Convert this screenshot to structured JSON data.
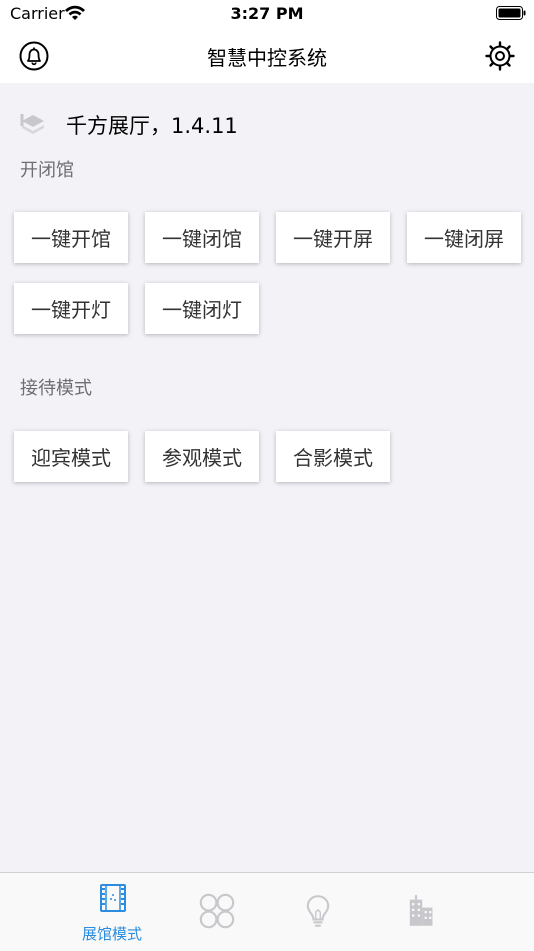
{
  "status_bar": {
    "carrier": "Carrier",
    "time": "3:27 PM"
  },
  "nav": {
    "title": "智慧中控系统",
    "left_icon": "bell-icon",
    "right_icon": "gear-icon"
  },
  "hall": {
    "name": "千方展厅，1.4.11",
    "icon": "layers-icon"
  },
  "sections": [
    {
      "title": "开闭馆",
      "buttons": [
        "一键开馆",
        "一键闭馆",
        "一键开屏",
        "一键闭屏",
        "一键开灯",
        "一键闭灯"
      ]
    },
    {
      "title": "接待模式",
      "buttons": [
        "迎宾模式",
        "参观模式",
        "合影模式"
      ]
    }
  ],
  "tabs": [
    {
      "label": "展馆模式",
      "icon": "film-icon",
      "active": true
    },
    {
      "label": "",
      "icon": "grid-icon",
      "active": false
    },
    {
      "label": "",
      "icon": "lightbulb-icon",
      "active": false
    },
    {
      "label": "",
      "icon": "building-icon",
      "active": false
    }
  ],
  "colors": {
    "accent": "#2b8de0",
    "background": "#f2f2f7",
    "inactive_icon": "#c7c7cc"
  }
}
